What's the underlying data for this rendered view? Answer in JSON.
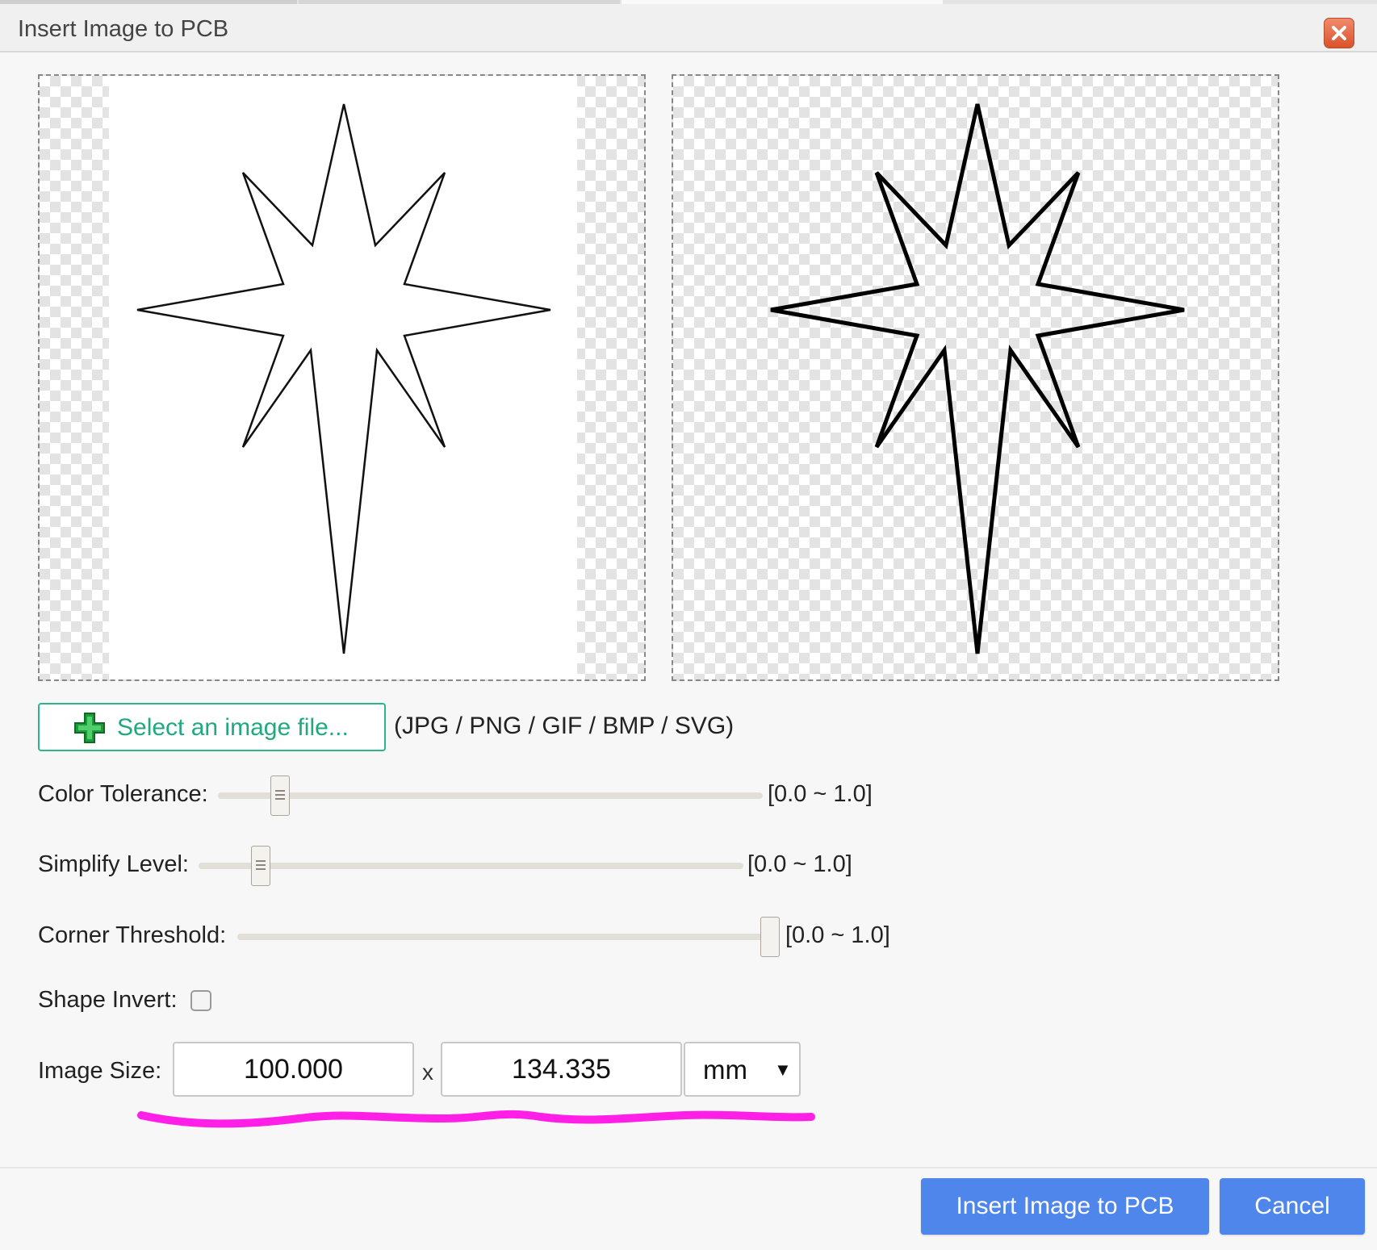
{
  "dialog": {
    "title": "Insert Image to PCB",
    "close_icon": "close-icon"
  },
  "preview": {
    "source_alt": "source image preview",
    "result_alt": "traced result preview"
  },
  "file": {
    "select_label": "Select an image file...",
    "formats": "(JPG / PNG / GIF / BMP / SVG)",
    "icon": "plus-icon"
  },
  "controls": {
    "color_tolerance": {
      "label": "Color Tolerance:",
      "range": "[0.0 ~ 1.0]",
      "value": 0.11
    },
    "simplify_level": {
      "label": "Simplify Level:",
      "range": "[0.0 ~ 1.0]",
      "value": 0.11
    },
    "corner_threshold": {
      "label": "Corner Threshold:",
      "range": "[0.0 ~ 1.0]",
      "value": 1.0
    },
    "shape_invert": {
      "label": "Shape Invert:",
      "checked": false
    }
  },
  "image_size": {
    "label": "Image Size:",
    "width": "100.000",
    "height": "134.335",
    "separator": "x",
    "unit": "mm"
  },
  "buttons": {
    "insert": "Insert Image to PCB",
    "cancel": "Cancel"
  },
  "colors": {
    "primary": "#4f86ec",
    "select_border": "#2bb58d",
    "annotation": "#ff1fe6",
    "close": "#e0643f"
  }
}
